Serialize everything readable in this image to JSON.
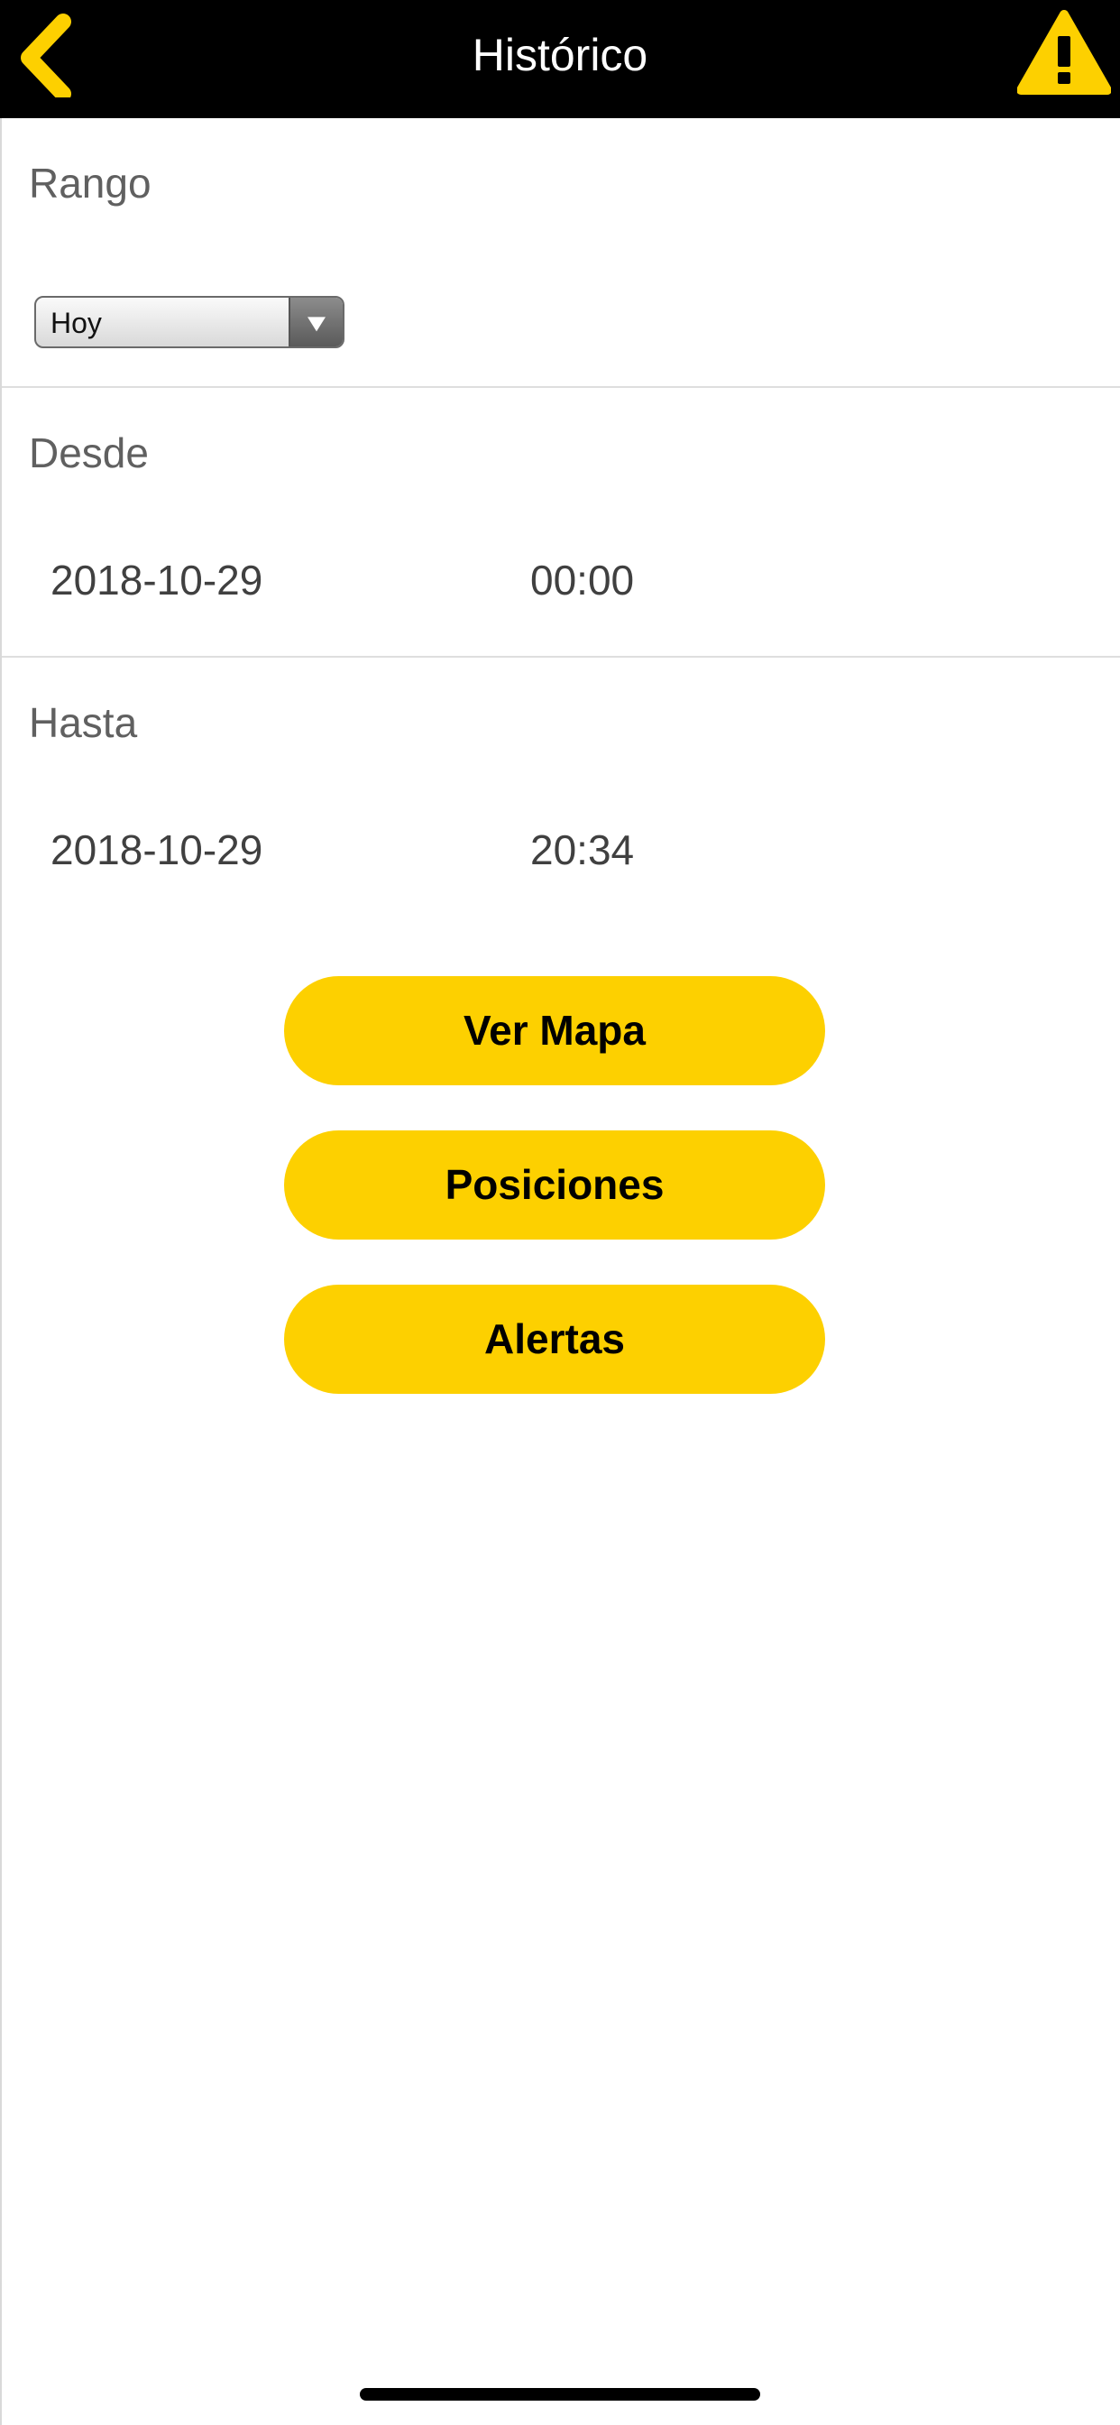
{
  "header": {
    "title": "Histórico",
    "back_icon": "chevron-left-icon",
    "alert_icon": "warning-icon",
    "accent_color": "#FDD000",
    "background_color": "#000000"
  },
  "range": {
    "label": "Rango",
    "selected": "Hoy"
  },
  "from": {
    "label": "Desde",
    "date": "2018-10-29",
    "time": "00:00"
  },
  "to": {
    "label": "Hasta",
    "date": "2018-10-29",
    "time": "20:34"
  },
  "actions": {
    "map_label": "Ver Mapa",
    "positions_label": "Posiciones",
    "alerts_label": "Alertas"
  }
}
